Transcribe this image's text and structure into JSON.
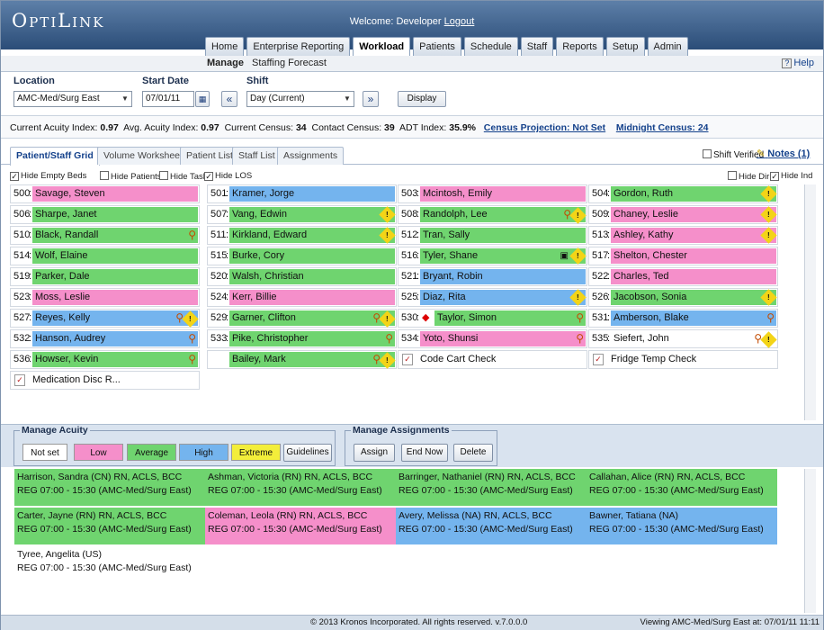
{
  "header": {
    "logo": "OptiLink",
    "welcome_prefix": "Welcome: Developer",
    "logout": "Logout",
    "nav_tabs": [
      "Home",
      "Enterprise Reporting",
      "Workload",
      "Patients",
      "Schedule",
      "Staff",
      "Reports",
      "Setup",
      "Admin"
    ],
    "active_tab": "Workload"
  },
  "subnav": {
    "manage": "Manage",
    "staffing_forecast": "Staffing Forecast",
    "help": "Help"
  },
  "filters": {
    "location_label": "Location",
    "location_value": "AMC-Med/Surg East",
    "start_date_label": "Start Date",
    "start_date_value": "07/01/11",
    "shift_label": "Shift",
    "shift_value": "Day (Current)",
    "prev": "«",
    "next": "»",
    "display": "Display"
  },
  "stats": {
    "current_acuity_label": "Current Acuity Index:",
    "current_acuity_value": "0.97",
    "avg_acuity_label": "Avg. Acuity Index:",
    "avg_acuity_value": "0.97",
    "current_census_label": "Current Census:",
    "current_census_value": "34",
    "contact_census_label": "Contact Census:",
    "contact_census_value": "39",
    "adt_label": "ADT Index:",
    "adt_value": "35.9%",
    "census_projection": "Census Projection: Not Set",
    "midnight_census": "Midnight Census: 24"
  },
  "tabs": [
    "Patient/Staff Grid",
    "Volume Worksheet",
    "Patient List",
    "Staff List",
    "Assignments"
  ],
  "shift_verified": "Shift Verified",
  "notes": "Notes (1)",
  "hide": {
    "empty_beds": "Hide Empty Beds",
    "patients": "Hide Patients",
    "tasks": "Hide Tasks",
    "los": "Hide LOS",
    "dir": "Hide Dir",
    "ind": "Hide Ind"
  },
  "grid": [
    [
      {
        "bed": "500",
        "name": "Savage, Steven",
        "color": "pink",
        "icons": ""
      },
      {
        "bed": "501",
        "name": "Kramer, Jorge",
        "color": "blue",
        "icons": ""
      },
      {
        "bed": "503",
        "name": "Mcintosh, Emily",
        "color": "pink",
        "icons": ""
      },
      {
        "bed": "504",
        "name": "Gordon, Ruth",
        "color": "green",
        "icons": "warn"
      }
    ],
    [
      {
        "bed": "506",
        "name": "Sharpe, Janet",
        "color": "green",
        "icons": ""
      },
      {
        "bed": "507",
        "name": "Vang, Edwin",
        "color": "green",
        "icons": "warn"
      },
      {
        "bed": "508",
        "name": "Randolph, Lee",
        "color": "green",
        "icons": "pers-warn"
      },
      {
        "bed": "509",
        "name": "Chaney, Leslie",
        "color": "pink",
        "icons": "warn"
      }
    ],
    [
      {
        "bed": "510",
        "name": "Black, Randall",
        "color": "green",
        "icons": "pers"
      },
      {
        "bed": "511",
        "name": "Kirkland, Edward",
        "color": "green",
        "icons": "warn"
      },
      {
        "bed": "512",
        "name": "Tran, Sally",
        "color": "green",
        "icons": ""
      },
      {
        "bed": "513",
        "name": "Ashley, Kathy",
        "color": "pink",
        "icons": "warn"
      }
    ],
    [
      {
        "bed": "514",
        "name": "Wolf, Elaine",
        "color": "green",
        "icons": ""
      },
      {
        "bed": "515",
        "name": "Burke, Cory",
        "color": "green",
        "icons": ""
      },
      {
        "bed": "516",
        "name": "Tyler, Shane",
        "color": "green",
        "icons": "box-warn"
      },
      {
        "bed": "517",
        "name": "Shelton, Chester",
        "color": "pink",
        "icons": ""
      }
    ],
    [
      {
        "bed": "519",
        "name": "Parker, Dale",
        "color": "green",
        "icons": ""
      },
      {
        "bed": "520",
        "name": "Walsh, Christian",
        "color": "green",
        "icons": ""
      },
      {
        "bed": "521",
        "name": "Bryant, Robin",
        "color": "blue",
        "icons": ""
      },
      {
        "bed": "522",
        "name": "Charles, Ted",
        "color": "pink",
        "icons": ""
      }
    ],
    [
      {
        "bed": "523",
        "name": "Moss, Leslie",
        "color": "pink",
        "icons": ""
      },
      {
        "bed": "524",
        "name": "Kerr, Billie",
        "color": "pink",
        "icons": ""
      },
      {
        "bed": "525",
        "name": "Diaz, Rita",
        "color": "blue",
        "icons": "warn"
      },
      {
        "bed": "526",
        "name": "Jacobson, Sonia",
        "color": "green",
        "icons": "warn"
      }
    ],
    [
      {
        "bed": "527",
        "name": "Reyes, Kelly",
        "color": "blue",
        "icons": "pers-warn"
      },
      {
        "bed": "529",
        "name": "Garner, Clifton",
        "color": "green",
        "icons": "pers-warn"
      },
      {
        "bed": "530",
        "name": "Taylor, Simon",
        "color": "green",
        "icons": "pers",
        "prefix": "diamond"
      },
      {
        "bed": "531",
        "name": "Amberson, Blake",
        "color": "blue",
        "icons": "pers"
      }
    ],
    [
      {
        "bed": "532",
        "name": "Hanson, Audrey",
        "color": "blue",
        "icons": "pers"
      },
      {
        "bed": "533",
        "name": "Pike, Christopher",
        "color": "green",
        "icons": "pers"
      },
      {
        "bed": "534",
        "name": "Yoto, Shunsi",
        "color": "pink",
        "icons": "pers"
      },
      {
        "bed": "535",
        "name": "Siefert, John",
        "color": "white",
        "icons": "pers-warn"
      }
    ],
    [
      {
        "bed": "536",
        "name": "Howser, Kevin",
        "color": "green",
        "icons": "pers"
      },
      {
        "bed": "",
        "name": "Bailey, Mark",
        "color": "green",
        "icons": "pers-warn"
      },
      {
        "bed": "",
        "name": "Code Cart Check",
        "color": "task",
        "icons": ""
      },
      {
        "bed": "",
        "name": "Fridge Temp Check",
        "color": "task",
        "icons": ""
      }
    ],
    [
      {
        "bed": "",
        "name": "Medication Disc R...",
        "color": "task",
        "icons": ""
      }
    ]
  ],
  "acuity": {
    "title": "Manage Acuity",
    "buttons": [
      "Not set",
      "Low",
      "Average",
      "High",
      "Extreme"
    ],
    "guidelines": "Guidelines"
  },
  "assignments": {
    "title": "Manage Assignments",
    "buttons": [
      "Assign",
      "End Now",
      "Delete"
    ]
  },
  "staff": [
    [
      {
        "name": "Harrison, Sandra (CN) RN, ACLS, BCC",
        "shift": "REG 07:00 - 15:30 (AMC-Med/Surg East)",
        "color": "green"
      },
      {
        "name": "Ashman, Victoria (RN) RN, ACLS, BCC",
        "shift": "REG 07:00 - 15:30 (AMC-Med/Surg East)",
        "color": "green"
      },
      {
        "name": "Barringer, Nathaniel (RN) RN, ACLS, BCC",
        "shift": "REG 07:00 - 15:30 (AMC-Med/Surg East)",
        "color": "green"
      },
      {
        "name": "Callahan, Alice (RN) RN, ACLS, BCC",
        "shift": "REG 07:00 - 15:30 (AMC-Med/Surg East)",
        "color": "green"
      }
    ],
    [
      {
        "name": "Carter, Jayne (RN) RN, ACLS, BCC",
        "shift": "REG 07:00 - 15:30 (AMC-Med/Surg East)",
        "color": "green"
      },
      {
        "name": "Coleman, Leola (RN) RN, ACLS, BCC",
        "shift": "REG 07:00 - 15:30 (AMC-Med/Surg East)",
        "color": "pink"
      },
      {
        "name": "Avery, Melissa (NA) RN, ACLS, BCC",
        "shift": "REG 07:00 - 15:30 (AMC-Med/Surg East)",
        "color": "blue"
      },
      {
        "name": "Bawner, Tatiana (NA)",
        "shift": "REG 07:00 - 15:30 (AMC-Med/Surg East)",
        "color": "blue"
      }
    ],
    [
      {
        "name": "Tyree, Angelita (US)",
        "shift": "REG 07:00 - 15:30 (AMC-Med/Surg East)",
        "color": "white"
      }
    ]
  ],
  "footer": {
    "copyright": "© 2013 Kronos Incorporated. All rights reserved. v.7.0.0.0",
    "viewing": "Viewing AMC-Med/Surg East at: 07/01/11 11:11"
  },
  "colors": {
    "pink": "#f58fca",
    "green": "#6fd46f",
    "blue": "#74b4ee",
    "extreme": "#f3ee3a",
    "header": "#2b4d78"
  }
}
